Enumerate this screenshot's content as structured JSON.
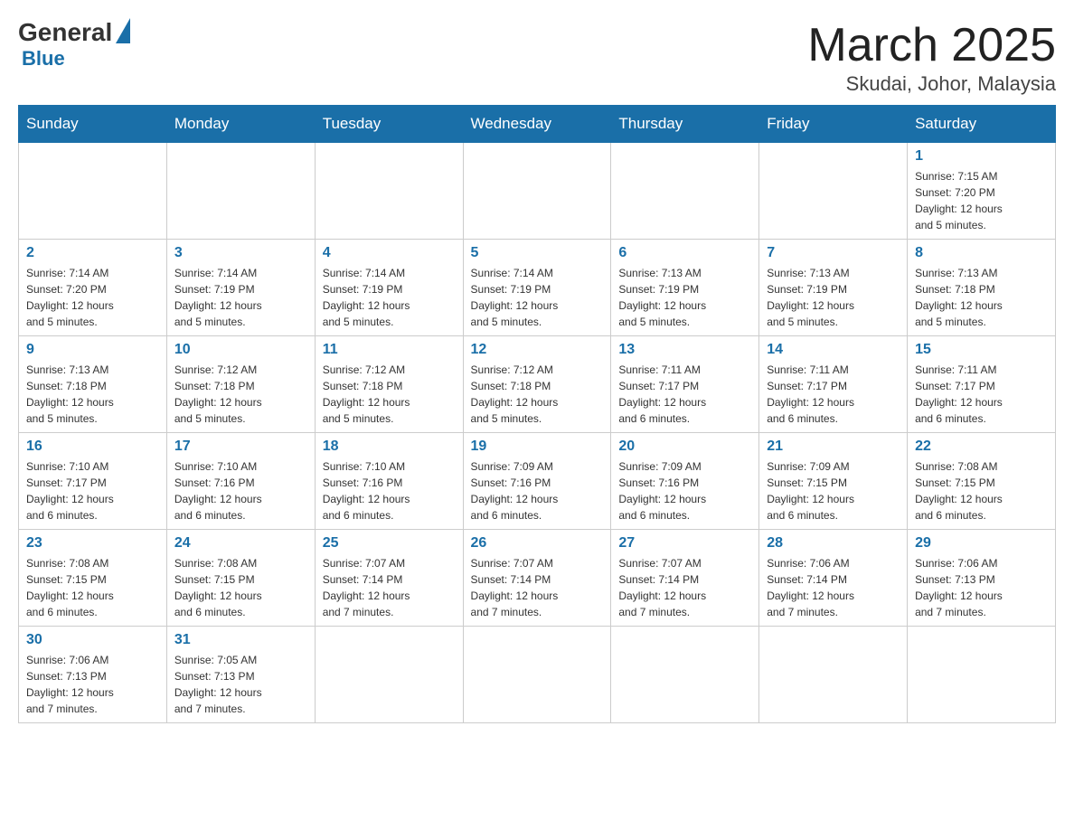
{
  "logo": {
    "general": "General",
    "blue": "Blue"
  },
  "header": {
    "month": "March 2025",
    "location": "Skudai, Johor, Malaysia"
  },
  "weekdays": [
    "Sunday",
    "Monday",
    "Tuesday",
    "Wednesday",
    "Thursday",
    "Friday",
    "Saturday"
  ],
  "weeks": [
    [
      {
        "day": "",
        "info": ""
      },
      {
        "day": "",
        "info": ""
      },
      {
        "day": "",
        "info": ""
      },
      {
        "day": "",
        "info": ""
      },
      {
        "day": "",
        "info": ""
      },
      {
        "day": "",
        "info": ""
      },
      {
        "day": "1",
        "info": "Sunrise: 7:15 AM\nSunset: 7:20 PM\nDaylight: 12 hours\nand 5 minutes."
      }
    ],
    [
      {
        "day": "2",
        "info": "Sunrise: 7:14 AM\nSunset: 7:20 PM\nDaylight: 12 hours\nand 5 minutes."
      },
      {
        "day": "3",
        "info": "Sunrise: 7:14 AM\nSunset: 7:19 PM\nDaylight: 12 hours\nand 5 minutes."
      },
      {
        "day": "4",
        "info": "Sunrise: 7:14 AM\nSunset: 7:19 PM\nDaylight: 12 hours\nand 5 minutes."
      },
      {
        "day": "5",
        "info": "Sunrise: 7:14 AM\nSunset: 7:19 PM\nDaylight: 12 hours\nand 5 minutes."
      },
      {
        "day": "6",
        "info": "Sunrise: 7:13 AM\nSunset: 7:19 PM\nDaylight: 12 hours\nand 5 minutes."
      },
      {
        "day": "7",
        "info": "Sunrise: 7:13 AM\nSunset: 7:19 PM\nDaylight: 12 hours\nand 5 minutes."
      },
      {
        "day": "8",
        "info": "Sunrise: 7:13 AM\nSunset: 7:18 PM\nDaylight: 12 hours\nand 5 minutes."
      }
    ],
    [
      {
        "day": "9",
        "info": "Sunrise: 7:13 AM\nSunset: 7:18 PM\nDaylight: 12 hours\nand 5 minutes."
      },
      {
        "day": "10",
        "info": "Sunrise: 7:12 AM\nSunset: 7:18 PM\nDaylight: 12 hours\nand 5 minutes."
      },
      {
        "day": "11",
        "info": "Sunrise: 7:12 AM\nSunset: 7:18 PM\nDaylight: 12 hours\nand 5 minutes."
      },
      {
        "day": "12",
        "info": "Sunrise: 7:12 AM\nSunset: 7:18 PM\nDaylight: 12 hours\nand 5 minutes."
      },
      {
        "day": "13",
        "info": "Sunrise: 7:11 AM\nSunset: 7:17 PM\nDaylight: 12 hours\nand 6 minutes."
      },
      {
        "day": "14",
        "info": "Sunrise: 7:11 AM\nSunset: 7:17 PM\nDaylight: 12 hours\nand 6 minutes."
      },
      {
        "day": "15",
        "info": "Sunrise: 7:11 AM\nSunset: 7:17 PM\nDaylight: 12 hours\nand 6 minutes."
      }
    ],
    [
      {
        "day": "16",
        "info": "Sunrise: 7:10 AM\nSunset: 7:17 PM\nDaylight: 12 hours\nand 6 minutes."
      },
      {
        "day": "17",
        "info": "Sunrise: 7:10 AM\nSunset: 7:16 PM\nDaylight: 12 hours\nand 6 minutes."
      },
      {
        "day": "18",
        "info": "Sunrise: 7:10 AM\nSunset: 7:16 PM\nDaylight: 12 hours\nand 6 minutes."
      },
      {
        "day": "19",
        "info": "Sunrise: 7:09 AM\nSunset: 7:16 PM\nDaylight: 12 hours\nand 6 minutes."
      },
      {
        "day": "20",
        "info": "Sunrise: 7:09 AM\nSunset: 7:16 PM\nDaylight: 12 hours\nand 6 minutes."
      },
      {
        "day": "21",
        "info": "Sunrise: 7:09 AM\nSunset: 7:15 PM\nDaylight: 12 hours\nand 6 minutes."
      },
      {
        "day": "22",
        "info": "Sunrise: 7:08 AM\nSunset: 7:15 PM\nDaylight: 12 hours\nand 6 minutes."
      }
    ],
    [
      {
        "day": "23",
        "info": "Sunrise: 7:08 AM\nSunset: 7:15 PM\nDaylight: 12 hours\nand 6 minutes."
      },
      {
        "day": "24",
        "info": "Sunrise: 7:08 AM\nSunset: 7:15 PM\nDaylight: 12 hours\nand 6 minutes."
      },
      {
        "day": "25",
        "info": "Sunrise: 7:07 AM\nSunset: 7:14 PM\nDaylight: 12 hours\nand 7 minutes."
      },
      {
        "day": "26",
        "info": "Sunrise: 7:07 AM\nSunset: 7:14 PM\nDaylight: 12 hours\nand 7 minutes."
      },
      {
        "day": "27",
        "info": "Sunrise: 7:07 AM\nSunset: 7:14 PM\nDaylight: 12 hours\nand 7 minutes."
      },
      {
        "day": "28",
        "info": "Sunrise: 7:06 AM\nSunset: 7:14 PM\nDaylight: 12 hours\nand 7 minutes."
      },
      {
        "day": "29",
        "info": "Sunrise: 7:06 AM\nSunset: 7:13 PM\nDaylight: 12 hours\nand 7 minutes."
      }
    ],
    [
      {
        "day": "30",
        "info": "Sunrise: 7:06 AM\nSunset: 7:13 PM\nDaylight: 12 hours\nand 7 minutes."
      },
      {
        "day": "31",
        "info": "Sunrise: 7:05 AM\nSunset: 7:13 PM\nDaylight: 12 hours\nand 7 minutes."
      },
      {
        "day": "",
        "info": ""
      },
      {
        "day": "",
        "info": ""
      },
      {
        "day": "",
        "info": ""
      },
      {
        "day": "",
        "info": ""
      },
      {
        "day": "",
        "info": ""
      }
    ]
  ]
}
